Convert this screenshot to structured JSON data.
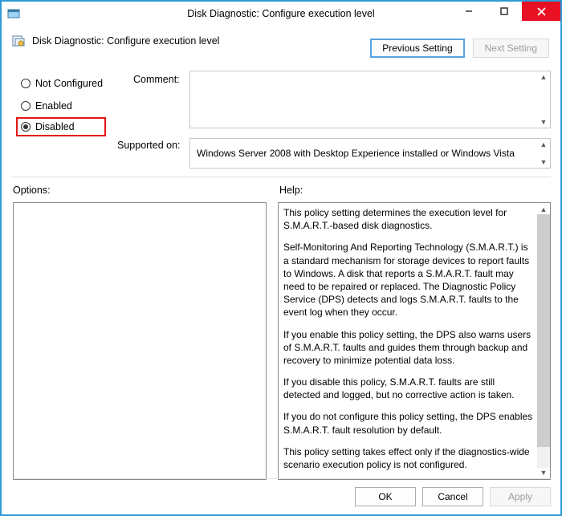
{
  "window": {
    "title": "Disk Diagnostic: Configure execution level"
  },
  "header": {
    "title": "Disk Diagnostic: Configure execution level"
  },
  "nav": {
    "previous": "Previous Setting",
    "next": "Next Setting"
  },
  "radios": {
    "not_configured": "Not Configured",
    "enabled": "Enabled",
    "disabled": "Disabled",
    "selected": "disabled"
  },
  "labels": {
    "comment": "Comment:",
    "supported_on": "Supported on:",
    "options": "Options:",
    "help": "Help:"
  },
  "comment": "",
  "supported_on": "Windows Server 2008 with Desktop Experience installed or Windows Vista",
  "help_paragraphs": [
    "This policy setting determines the execution level for S.M.A.R.T.-based disk diagnostics.",
    "Self-Monitoring And Reporting Technology (S.M.A.R.T.) is a standard mechanism for storage devices to report faults to Windows. A disk that reports a S.M.A.R.T. fault may need to be repaired or replaced. The Diagnostic Policy Service (DPS) detects and logs S.M.A.R.T. faults to the event log when they occur.",
    "If you enable this policy setting, the DPS also warns users of S.M.A.R.T. faults and guides them through backup and recovery to minimize potential data loss.",
    "If you disable this policy, S.M.A.R.T. faults are still detected and logged, but no corrective action is taken.",
    "If you do not configure this policy setting, the DPS enables S.M.A.R.T. fault resolution by default.",
    "This policy setting takes effect only if the diagnostics-wide scenario execution policy is not configured."
  ],
  "footer": {
    "ok": "OK",
    "cancel": "Cancel",
    "apply": "Apply"
  }
}
